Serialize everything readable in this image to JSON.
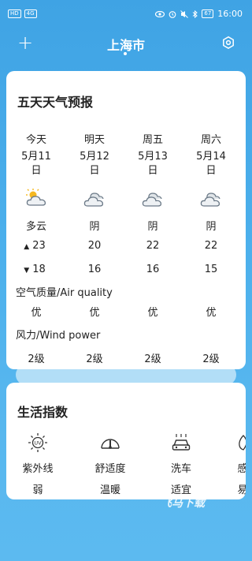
{
  "status_bar": {
    "left_badge_1": "HD",
    "left_badge_2": "4G",
    "battery": "67",
    "time": "16:00"
  },
  "header": {
    "add_label": "+",
    "city": "上海市"
  },
  "forecast": {
    "title": "五天天气预报",
    "days": [
      {
        "name": "今天",
        "date": "5月11日",
        "icon": "partly-cloudy-icon",
        "condition": "多云",
        "high": "23",
        "low": "18",
        "aqi": "优",
        "wind": "2级"
      },
      {
        "name": "明天",
        "date": "5月12日",
        "icon": "cloudy-icon",
        "condition": "阴",
        "high": "20",
        "low": "16",
        "aqi": "优",
        "wind": "2级"
      },
      {
        "name": "周五",
        "date": "5月13日",
        "icon": "cloudy-icon",
        "condition": "阴",
        "high": "22",
        "low": "16",
        "aqi": "优",
        "wind": "2级"
      },
      {
        "name": "周六",
        "date": "5月14日",
        "icon": "cloudy-icon",
        "condition": "阴",
        "high": "22",
        "low": "15",
        "aqi": "优",
        "wind": "2级"
      }
    ],
    "high_arrow": "▲",
    "low_arrow": "▼",
    "air_quality_label": "空气质量/Air quality",
    "wind_label": "风力/Wind power"
  },
  "life": {
    "title": "生活指数",
    "items": [
      {
        "name": "紫外线",
        "value": "弱",
        "icon": "uv-icon"
      },
      {
        "name": "舒适度",
        "value": "温暖",
        "icon": "gauge-icon"
      },
      {
        "name": "洗车",
        "value": "适宜",
        "icon": "car-wash-icon"
      },
      {
        "name": "感",
        "value": "易",
        "icon": "cold-icon"
      }
    ]
  },
  "watermark": "飞马下载",
  "colors": {
    "background": "#4cb0ec",
    "card": "#ffffff"
  }
}
